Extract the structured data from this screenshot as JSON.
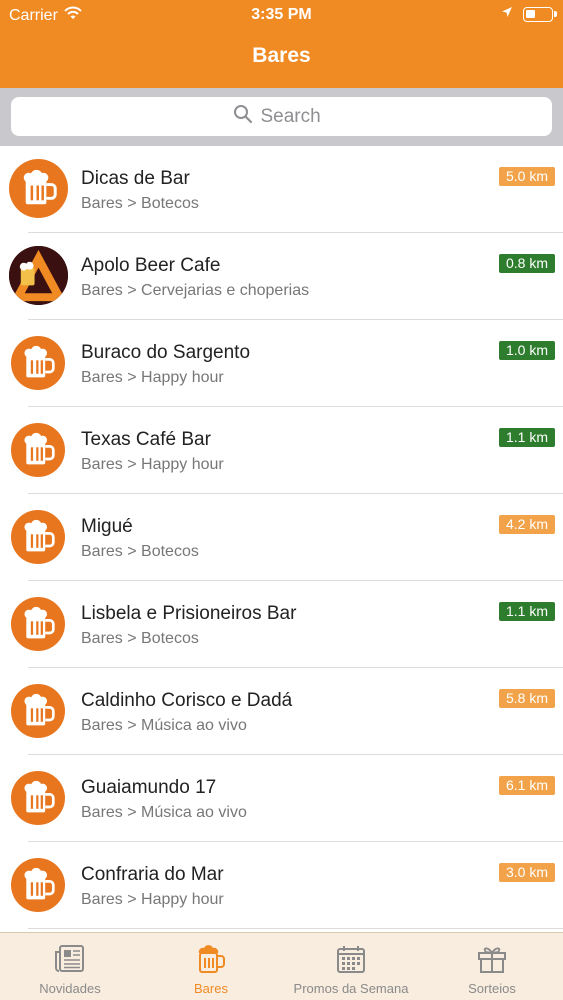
{
  "status_bar": {
    "carrier": "Carrier",
    "time": "3:35 PM"
  },
  "nav": {
    "title": "Bares"
  },
  "search": {
    "placeholder": "Search"
  },
  "bars": [
    {
      "name": "Dicas de Bar",
      "category": "Bares > Botecos",
      "distance": "5.0 km",
      "badge_color": "orange"
    },
    {
      "name": "Apolo Beer Cafe",
      "category": "Bares > Cervejarias e choperias",
      "distance": "0.8 km",
      "badge_color": "green"
    },
    {
      "name": "Buraco do Sargento",
      "category": "Bares > Happy hour",
      "distance": "1.0 km",
      "badge_color": "green"
    },
    {
      "name": "Texas Café Bar",
      "category": "Bares > Happy hour",
      "distance": "1.1 km",
      "badge_color": "green"
    },
    {
      "name": "Migué",
      "category": "Bares > Botecos",
      "distance": "4.2 km",
      "badge_color": "orange"
    },
    {
      "name": "Lisbela e Prisioneiros Bar",
      "category": "Bares > Botecos",
      "distance": "1.1 km",
      "badge_color": "green"
    },
    {
      "name": "Caldinho Corisco e Dadá",
      "category": "Bares > Música ao vivo",
      "distance": "5.8 km",
      "badge_color": "orange"
    },
    {
      "name": "Guaiamundo 17",
      "category": "Bares > Música ao vivo",
      "distance": "6.1 km",
      "badge_color": "orange"
    },
    {
      "name": "Confraria do Mar",
      "category": "Bares > Happy hour",
      "distance": "3.0 km",
      "badge_color": "orange"
    }
  ],
  "tabs": [
    {
      "label": "Novidades",
      "icon": "newspaper-icon",
      "active": false
    },
    {
      "label": "Bares",
      "icon": "beer-mug-icon",
      "active": true
    },
    {
      "label": "Promos da Semana",
      "icon": "calendar-icon",
      "active": false
    },
    {
      "label": "Sorteios",
      "icon": "gift-icon",
      "active": false
    }
  ],
  "colors": {
    "accent": "#f08a23",
    "badge_orange": "#f2a34a",
    "badge_green": "#2e7d2e",
    "search_bar_bg": "#c8c8cd"
  }
}
